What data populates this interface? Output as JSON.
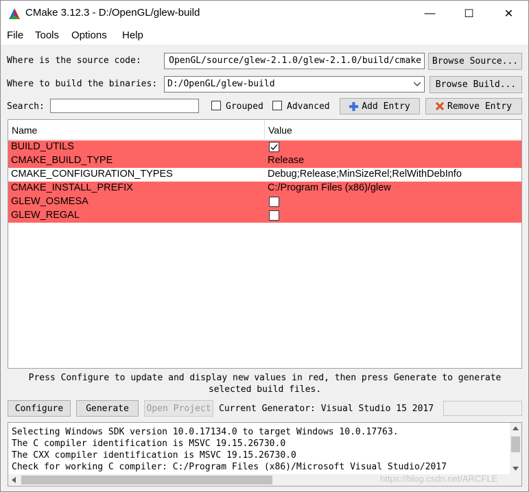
{
  "window": {
    "title": "CMake 3.12.3 - D:/OpenGL/glew-build",
    "minimize_glyph": "—",
    "maximize_glyph": "☐",
    "close_glyph": "✕"
  },
  "menu": {
    "items": [
      "File",
      "Tools",
      "Options",
      "Help"
    ]
  },
  "source": {
    "label": "Where is the source code:",
    "value": "OpenGL/source/glew-2.1.0/glew-2.1.0/build/cmake",
    "browse_label": "Browse Source..."
  },
  "binaries": {
    "label": "Where to build the binaries:",
    "value": "D:/OpenGL/glew-build",
    "browse_label": "Browse Build..."
  },
  "search": {
    "label": "Search:",
    "value": "",
    "grouped_label": "Grouped",
    "grouped_checked": false,
    "advanced_label": "Advanced",
    "advanced_checked": false,
    "add_entry_label": "Add Entry",
    "remove_entry_label": "Remove Entry"
  },
  "table": {
    "headers": {
      "name": "Name",
      "value": "Value"
    },
    "rows": [
      {
        "name": "BUILD_UTILS",
        "value": "",
        "type": "bool",
        "checked": true,
        "highlighted": true
      },
      {
        "name": "CMAKE_BUILD_TYPE",
        "value": "Release",
        "type": "text",
        "checked": false,
        "highlighted": true
      },
      {
        "name": "CMAKE_CONFIGURATION_TYPES",
        "value": "Debug;Release;MinSizeRel;RelWithDebInfo",
        "type": "text",
        "checked": false,
        "highlighted": false
      },
      {
        "name": "CMAKE_INSTALL_PREFIX",
        "value": "C:/Program Files (x86)/glew",
        "type": "text",
        "checked": false,
        "highlighted": true
      },
      {
        "name": "GLEW_OSMESA",
        "value": "",
        "type": "bool",
        "checked": false,
        "highlighted": true
      },
      {
        "name": "GLEW_REGAL",
        "value": "",
        "type": "bool",
        "checked": false,
        "highlighted": true
      }
    ]
  },
  "info": {
    "line1": "Press Configure to update and display new values in red, then press Generate to generate",
    "line2": "selected build files."
  },
  "actions": {
    "configure_label": "Configure",
    "generate_label": "Generate",
    "open_project_label": "Open Project",
    "generator_text": "Current Generator: Visual Studio 15 2017"
  },
  "output": {
    "lines": [
      "Selecting Windows SDK version 10.0.17134.0 to target Windows 10.0.17763.",
      "The C compiler identification is MSVC 19.15.26730.0",
      "The CXX compiler identification is MSVC 19.15.26730.0",
      "Check for working C compiler: C:/Program Files (x86)/Microsoft Visual Studio/2017"
    ]
  },
  "watermark": "https://blog.csdn.net/ARCFLE",
  "colors": {
    "highlight_red": "#ff6464",
    "add_icon": "#3a6fd8",
    "remove_icon": "#e0502a"
  }
}
